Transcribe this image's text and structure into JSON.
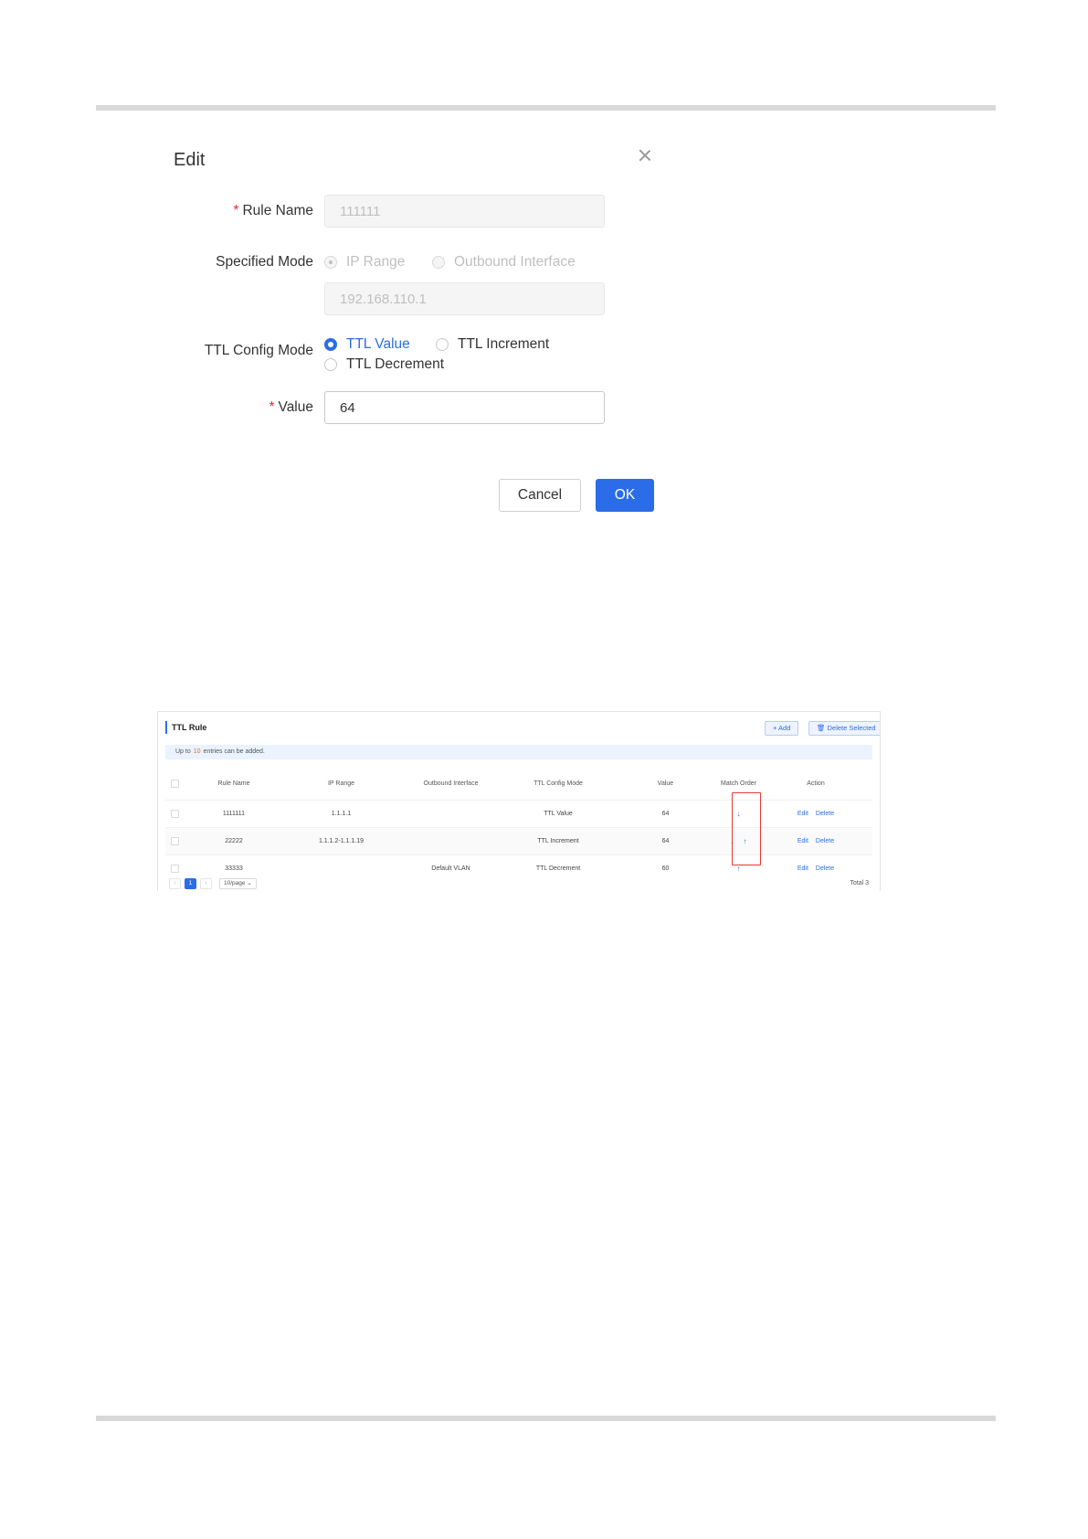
{
  "dialog": {
    "title": "Edit",
    "rule_name": {
      "label": "Rule Name",
      "required_mark": "*",
      "value": "111111"
    },
    "specified_mode": {
      "label": "Specified Mode",
      "options": [
        "IP Range",
        "Outbound Interface"
      ],
      "selected": "IP Range",
      "ip_value": "192.168.110.1"
    },
    "ttl_config_mode": {
      "label": "TTL Config Mode",
      "options": [
        "TTL Value",
        "TTL Increment",
        "TTL Decrement"
      ],
      "selected": "TTL Value"
    },
    "value": {
      "label": "Value",
      "required_mark": "*",
      "value": "64"
    },
    "cancel_label": "Cancel",
    "ok_label": "OK",
    "accent": "#2b6de8"
  },
  "ttl_rule": {
    "title": "TTL Rule",
    "add_label": "+ Add",
    "delete_selected_label": "Delete Selected",
    "note": {
      "prefix": "Up to",
      "count": "10",
      "suffix": "entries can be added."
    },
    "columns": [
      "Rule Name",
      "IP Range",
      "Outbound Interface",
      "TTL Config Mode",
      "Value",
      "Match Order",
      "Action"
    ],
    "rows": [
      {
        "rule_name": "1111111",
        "ip_range": "1.1.1.1",
        "outbound": "",
        "mode": "TTL Value",
        "value": "64",
        "down": "↓",
        "up": "",
        "edit": "Edit",
        "delete": "Delete"
      },
      {
        "rule_name": "22222",
        "ip_range": "1.1.1.2-1.1.1.19",
        "outbound": "",
        "mode": "TTL Increment",
        "value": "64",
        "down": "↓",
        "up": "↑",
        "edit": "Edit",
        "delete": "Delete"
      },
      {
        "rule_name": "33333",
        "ip_range": "",
        "outbound": "Default VLAN",
        "mode": "TTL Decrement",
        "value": "60",
        "down": "",
        "up": "↑",
        "edit": "Edit",
        "delete": "Delete"
      }
    ],
    "pagination": {
      "prev": "‹",
      "current_page": "1",
      "next": "›",
      "page_size": "10/page",
      "total": "Total 3"
    },
    "highlight_color": "#e53935"
  }
}
